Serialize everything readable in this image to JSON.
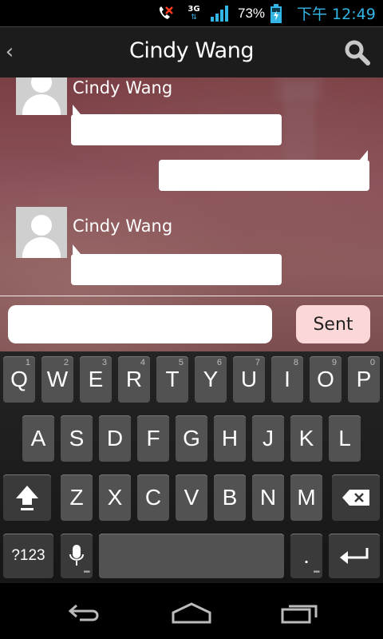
{
  "status_bar": {
    "network": "3G",
    "battery_percent": "73%",
    "time": "下午 12:49"
  },
  "action_bar": {
    "title": "Cindy Wang",
    "back_icon": "chevron-left-icon",
    "search_icon": "search-icon"
  },
  "messages": [
    {
      "side": "incoming",
      "sender": "Cindy Wang",
      "text": ""
    },
    {
      "side": "outgoing",
      "text": ""
    },
    {
      "side": "incoming",
      "sender": "Cindy Wang",
      "text": ""
    }
  ],
  "composer": {
    "input_value": "",
    "send_label": "Sent"
  },
  "keyboard": {
    "row1": [
      {
        "label": "Q",
        "hint": "1"
      },
      {
        "label": "W",
        "hint": "2"
      },
      {
        "label": "E",
        "hint": "3"
      },
      {
        "label": "R",
        "hint": "4"
      },
      {
        "label": "T",
        "hint": "5"
      },
      {
        "label": "Y",
        "hint": "6"
      },
      {
        "label": "U",
        "hint": "7"
      },
      {
        "label": "I",
        "hint": "8"
      },
      {
        "label": "O",
        "hint": "9"
      },
      {
        "label": "P",
        "hint": "0"
      }
    ],
    "row2": [
      "A",
      "S",
      "D",
      "F",
      "G",
      "H",
      "J",
      "K",
      "L"
    ],
    "row3": [
      "Z",
      "X",
      "C",
      "V",
      "B",
      "N",
      "M"
    ],
    "symbols_label": "?123",
    "period_label": ".",
    "colors": {
      "key": "#525252",
      "background": "#1c1c1c"
    }
  },
  "colors": {
    "accent": "#33b5e5",
    "send_button": "#fbd7d7"
  }
}
